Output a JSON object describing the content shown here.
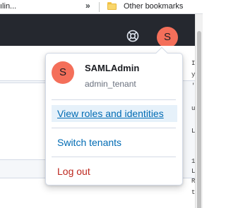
{
  "browser": {
    "bookmarks_bar": {
      "truncated_item": "ılin...",
      "overflow_glyph": "»",
      "other_bookmarks_label": "Other bookmarks"
    }
  },
  "header": {
    "user_avatar_initial": "S"
  },
  "user_menu": {
    "avatar_initial": "S",
    "username": "SAMLAdmin",
    "tenant": "admin_tenant",
    "items": [
      {
        "label": "View roles and identities",
        "state": "hovered"
      },
      {
        "label": "Switch tenants"
      },
      {
        "label": "Log out"
      }
    ]
  },
  "background_text": {
    "partial_glyphs": [
      "I",
      "y",
      "'",
      "us",
      "L",
      "1",
      "L",
      "R",
      "tl"
    ]
  },
  "colors": {
    "header_bg": "#25282f",
    "avatar": "#f46f5a",
    "link": "#006bb4",
    "danger": "#bd271e",
    "hover_bg": "#e6f1fa"
  }
}
